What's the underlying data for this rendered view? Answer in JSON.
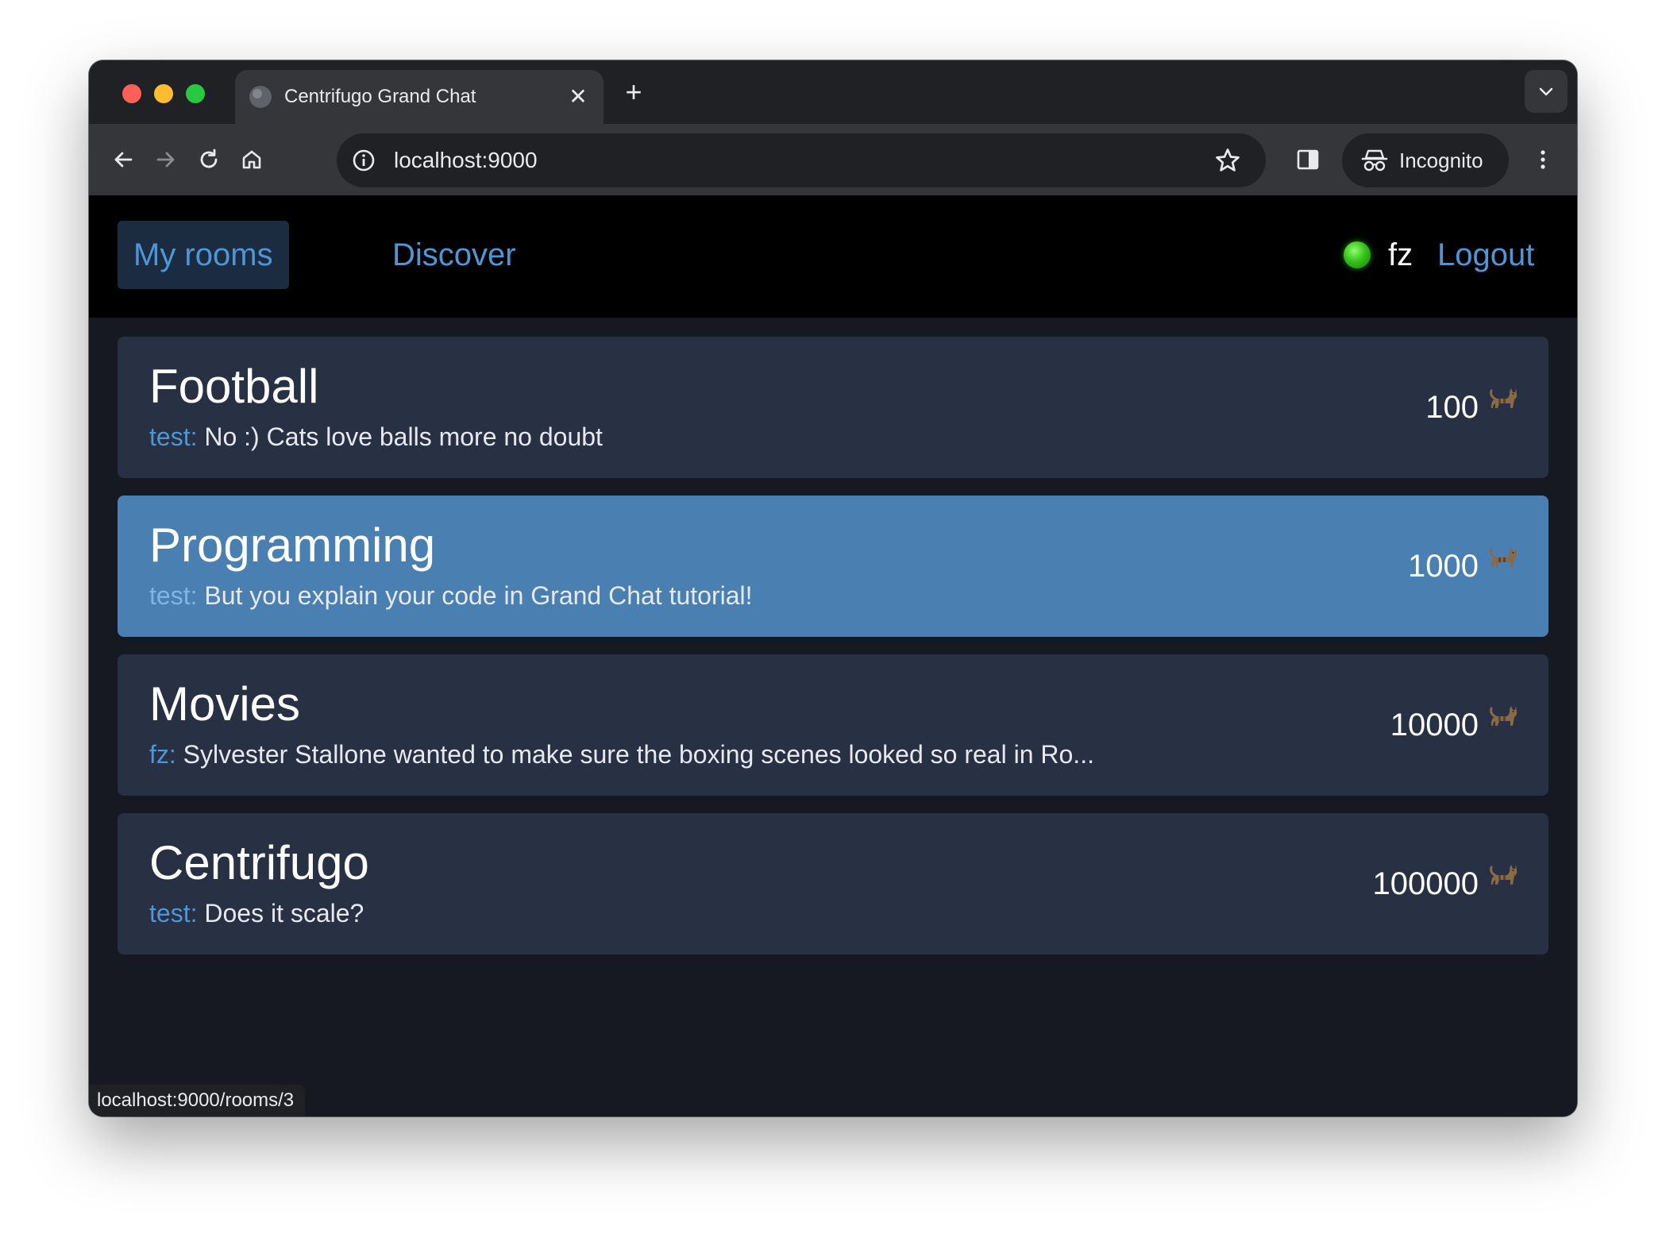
{
  "browser": {
    "tab_title": "Centrifugo Grand Chat",
    "tab_close": "✕",
    "new_tab": "+",
    "url": "localhost:9000",
    "incognito_label": "Incognito",
    "status_url": "localhost:9000/rooms/3"
  },
  "nav": {
    "my_rooms": "My rooms",
    "discover": "Discover"
  },
  "user": {
    "name": "fz",
    "logout": "Logout",
    "online": true
  },
  "rooms": [
    {
      "title": "Football",
      "author": "test:",
      "message": " No :) Cats love balls more no doubt",
      "count": "100",
      "active": false
    },
    {
      "title": "Programming",
      "author": "test:",
      "message": " But you explain your code in Grand Chat tutorial!",
      "count": "1000",
      "active": true
    },
    {
      "title": "Movies",
      "author": "fz:",
      "message": " Sylvester Stallone wanted to make sure the boxing scenes looked so real in Ro...",
      "count": "10000",
      "active": false
    },
    {
      "title": "Centrifugo",
      "author": "test:",
      "message": " Does it scale?",
      "count": "100000",
      "active": false
    }
  ],
  "colors": {
    "accent": "#4e96d6",
    "active_room": "#4a7fb1",
    "room_bg": "#283044",
    "status_online": "#37c21a"
  },
  "icons": {
    "member_icon": "cat-icon"
  }
}
